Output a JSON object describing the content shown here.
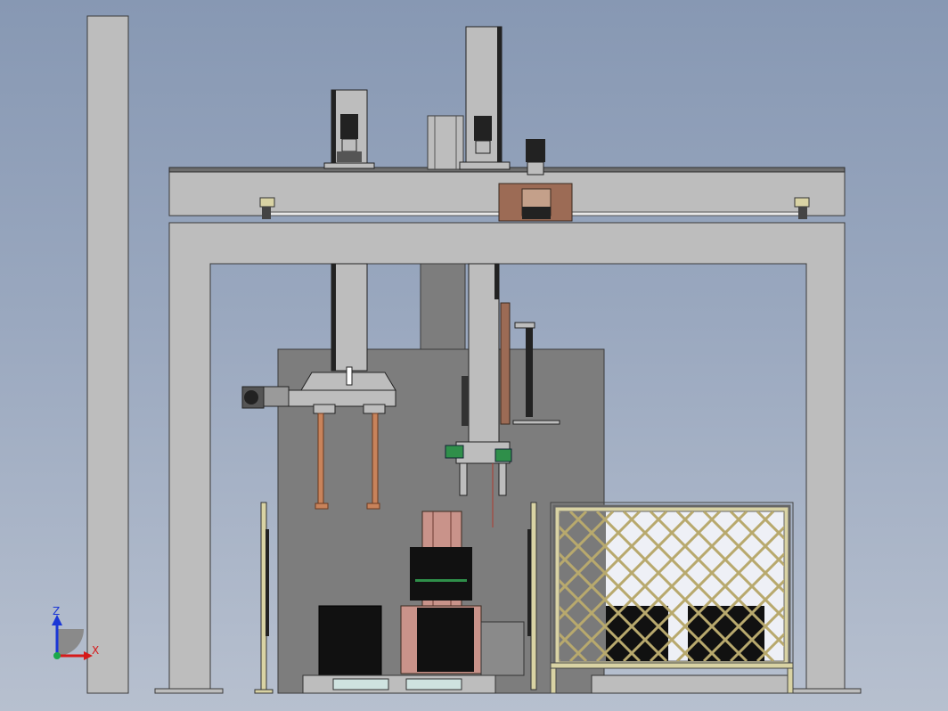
{
  "viewport": {
    "background_top": "#8798b3",
    "background_bottom": "#b7c0cf",
    "frame_color": "#bdbdbd",
    "frame_stroke": "#3a3a3a",
    "dark_gray": "#7a7a7a",
    "copper": "#c8835b",
    "brown": "#9c6b55",
    "green": "#2f8f4a",
    "cream": "#d9d3a4"
  },
  "triad": {
    "z_label": "Z",
    "x_label": "X",
    "z_color": "#1a36d6",
    "x_color": "#d61a1a",
    "y_color": "#1aa84a"
  }
}
